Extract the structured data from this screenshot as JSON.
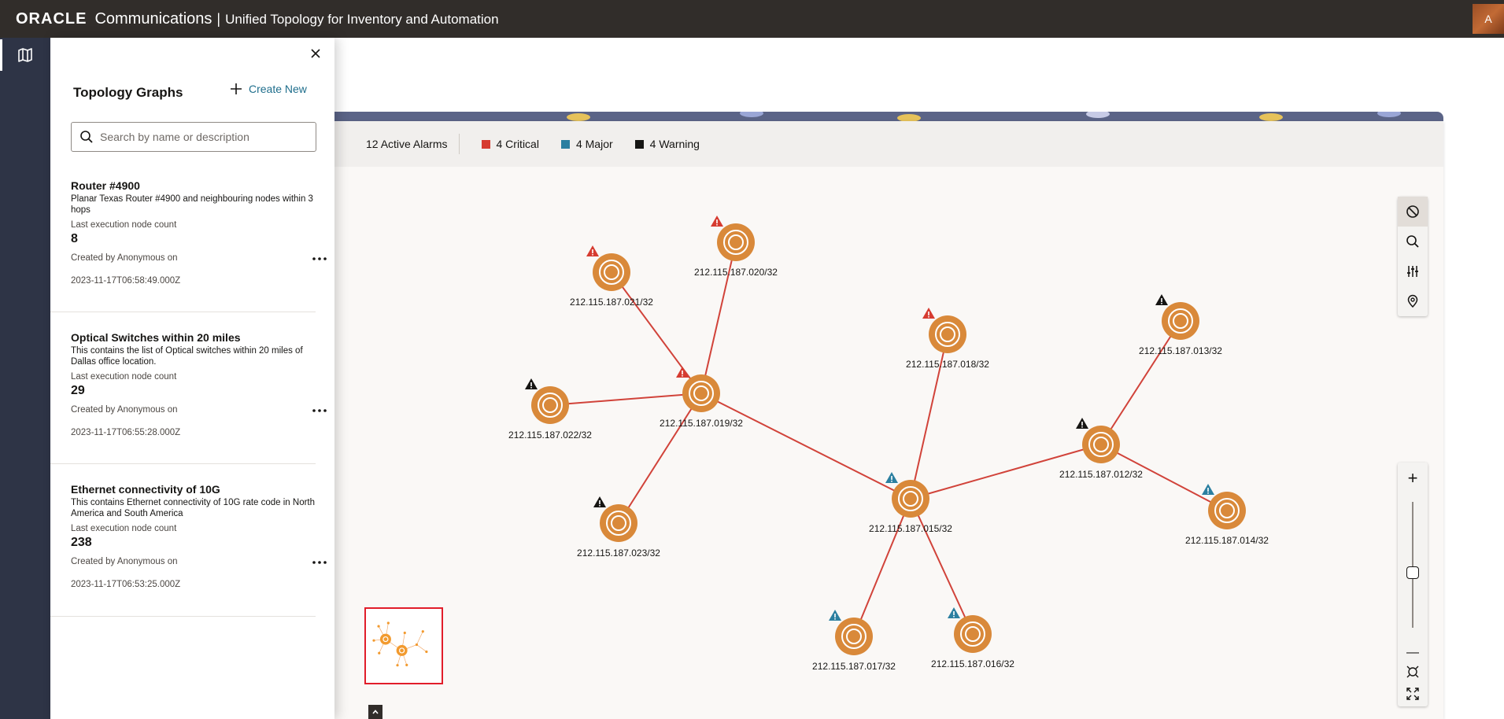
{
  "header": {
    "brand": "ORACLE",
    "product_family": "Communications",
    "separator": "|",
    "product_name": "Unified Topology for Inventory and Automation",
    "user_initial": "A"
  },
  "rail": {
    "items": [
      {
        "icon": "map-icon"
      }
    ]
  },
  "drawer": {
    "title": "Topology Graphs",
    "create_label": "Create New",
    "search_placeholder": "Search by name or description",
    "graphs": [
      {
        "name": "Router #4900",
        "description": "Planar Texas Router #4900 and neighbouring nodes within 3 hops",
        "count_label": "Last execution node count",
        "count": "8",
        "created_by": "Created by Anonymous on",
        "created_at": "2023-11-17T06:58:49.000Z"
      },
      {
        "name": "Optical Switches within 20 miles",
        "description": "This contains the list of Optical switches within 20 miles of Dallas office location.",
        "count_label": "Last execution node count",
        "count": "29",
        "created_by": "Created by Anonymous on",
        "created_at": "2023-11-17T06:55:28.000Z"
      },
      {
        "name": "Ethernet connectivity of 10G",
        "description": "This contains Ethernet connectivity of 10G rate code in North America and South America",
        "count_label": "Last execution node count",
        "count": "238",
        "created_by": "Created by Anonymous on",
        "created_at": "2023-11-17T06:53:25.000Z"
      }
    ]
  },
  "alarms": {
    "total_label": "12 Active Alarms",
    "critical": {
      "label": "4 Critical",
      "color": "#d63b30"
    },
    "major": {
      "label": "4 Major",
      "color": "#2b7fa0"
    },
    "warning": {
      "label": "4 Warning",
      "color": "#161513"
    }
  },
  "colors": {
    "node": "#d9893a",
    "link": "#d1433a",
    "accent": "#1f6e8c"
  },
  "topology": {
    "nodes": [
      {
        "id": "n021",
        "label": "212.115.187.021/32",
        "alarm": "critical"
      },
      {
        "id": "n020",
        "label": "212.115.187.020/32",
        "alarm": "critical"
      },
      {
        "id": "n022",
        "label": "212.115.187.022/32",
        "alarm": "warning"
      },
      {
        "id": "n019",
        "label": "212.115.187.019/32",
        "alarm": "critical"
      },
      {
        "id": "n023",
        "label": "212.115.187.023/32",
        "alarm": "warning"
      },
      {
        "id": "n018",
        "label": "212.115.187.018/32",
        "alarm": "critical"
      },
      {
        "id": "n015",
        "label": "212.115.187.015/32",
        "alarm": "major"
      },
      {
        "id": "n013",
        "label": "212.115.187.013/32",
        "alarm": "warning"
      },
      {
        "id": "n012",
        "label": "212.115.187.012/32",
        "alarm": "warning"
      },
      {
        "id": "n014",
        "label": "212.115.187.014/32",
        "alarm": "major"
      },
      {
        "id": "n017",
        "label": "212.115.187.017/32",
        "alarm": "major"
      },
      {
        "id": "n016",
        "label": "212.115.187.016/32",
        "alarm": "major"
      }
    ],
    "links": [
      [
        "n019",
        "n021"
      ],
      [
        "n019",
        "n020"
      ],
      [
        "n019",
        "n022"
      ],
      [
        "n019",
        "n023"
      ],
      [
        "n019",
        "n015"
      ],
      [
        "n015",
        "n018"
      ],
      [
        "n015",
        "n012"
      ],
      [
        "n015",
        "n017"
      ],
      [
        "n015",
        "n016"
      ],
      [
        "n012",
        "n013"
      ],
      [
        "n012",
        "n014"
      ]
    ]
  },
  "graph_tools": [
    {
      "name": "reset-icon"
    },
    {
      "name": "search-icon"
    },
    {
      "name": "filter-sliders-icon"
    },
    {
      "name": "location-pin-icon"
    }
  ],
  "zoom": {
    "level": 0.5,
    "in_label": "+",
    "out_label": "—"
  }
}
